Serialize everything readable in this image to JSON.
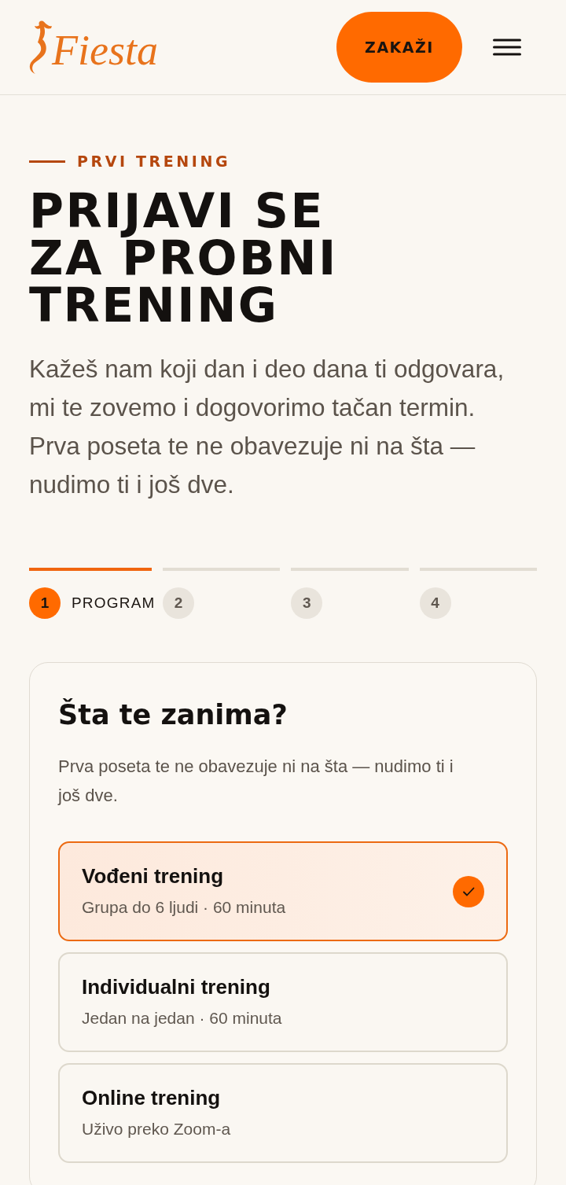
{
  "header": {
    "logo": "Fiesta",
    "cta_button": "ZAKAŽI"
  },
  "hero": {
    "eyebrow": "PRVI TRENING",
    "title": "PRIJAVI SE ZA PROBNI TRENING",
    "intro": "Kažeš nam koji dan i deo dana ti odgovara, mi te zovemo i dogovorimo tačan termin. Prva poseta te ne obavezuje ni na šta — nudimo ti i još dve."
  },
  "steps": [
    {
      "number": "1",
      "label": "PROGRAM",
      "selected": true
    },
    {
      "number": "2",
      "selected": false
    },
    {
      "number": "3",
      "selected": false
    },
    {
      "number": "4",
      "selected": false
    }
  ],
  "card": {
    "title": "Šta te zanima?",
    "subtitle": "Prva poseta te ne obavezuje ni na šta — nudimo ti i još dve.",
    "options": [
      {
        "title": "Vođeni trening",
        "subtitle": "Grupa do 6 ljudi · 60 minuta",
        "selected": true
      },
      {
        "title": "Individualni trening",
        "subtitle": "Jedan na jedan · 60 minuta",
        "selected": false
      },
      {
        "title": "Online trening",
        "subtitle": "Uživo preko Zoom-a",
        "selected": false
      }
    ]
  }
}
